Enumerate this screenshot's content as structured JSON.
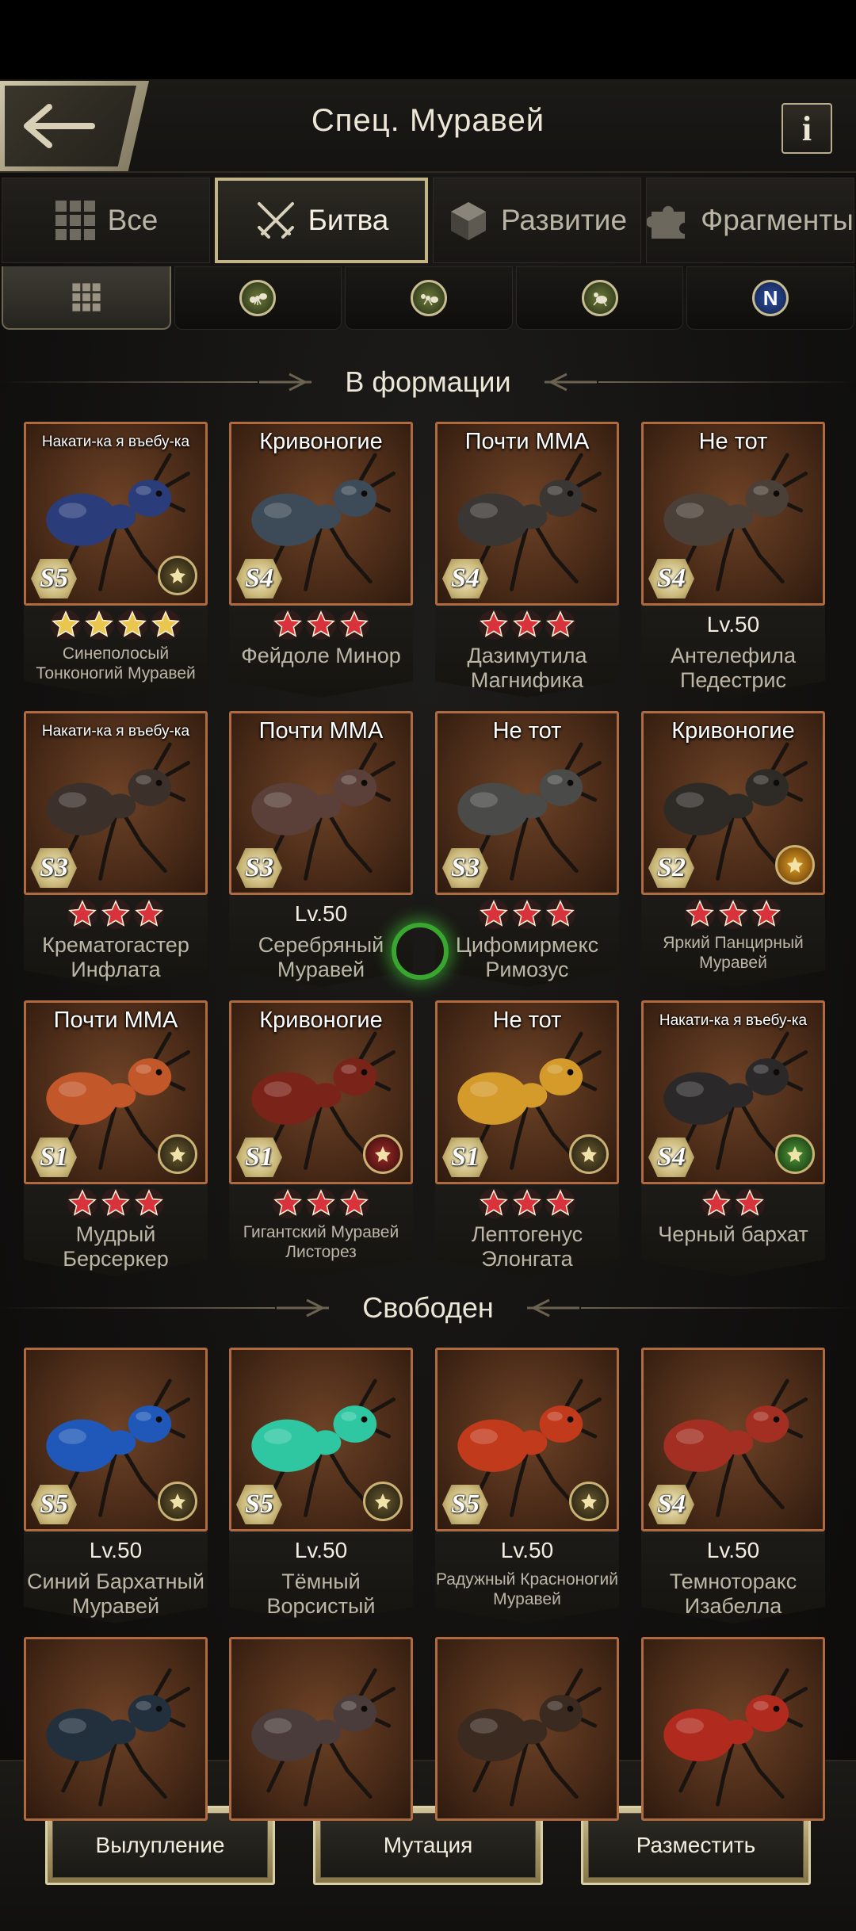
{
  "header": {
    "title": "Спец. Муравей",
    "info_label": "i"
  },
  "tabs": [
    {
      "label": "Все",
      "icon": "grid-icon",
      "active": false
    },
    {
      "label": "Битва",
      "icon": "crossed-swords-icon",
      "active": true
    },
    {
      "label": "Развитие",
      "icon": "cube-icon",
      "active": false
    },
    {
      "label": "Фрагменты",
      "icon": "puzzle-icon",
      "active": false
    }
  ],
  "subtabs": [
    {
      "icon": "grid-icon",
      "active": true
    },
    {
      "icon": "ant-type-icon",
      "active": false
    },
    {
      "icon": "ant-type-icon",
      "active": false
    },
    {
      "icon": "ant-type-icon",
      "active": false
    },
    {
      "icon": "n-rarity-icon",
      "label": "N",
      "active": false
    }
  ],
  "sections": {
    "in_formation": "В формации",
    "free": "Свободен"
  },
  "formation_cards": [
    {
      "tag": "Накати-ка я въебу-ка",
      "grade": "S5",
      "stars": 4,
      "star_color": "gold",
      "level": "",
      "name": "Синеполосый Тонконогий Муравей",
      "name_small": true,
      "body": "#2a3d7a",
      "badge": "gold"
    },
    {
      "tag": "Кривоногие",
      "grade": "S4",
      "stars": 3,
      "star_color": "red",
      "level": "",
      "name": "Фейдоле Минор",
      "name_small": false,
      "body": "#3d4a57",
      "badge": ""
    },
    {
      "tag": "Почти ММА",
      "grade": "S4",
      "stars": 3,
      "star_color": "red",
      "level": "",
      "name": "Дазимутила Магнифика",
      "name_small": false,
      "body": "#3a3634",
      "badge": ""
    },
    {
      "tag": "Не тот",
      "grade": "S4",
      "stars": 0,
      "star_color": "",
      "level": "Lv.50",
      "name": "Антелефила Педестрис",
      "name_small": false,
      "body": "#4a4038",
      "badge": ""
    },
    {
      "tag": "Накати-ка я въебу-ка",
      "grade": "S3",
      "stars": 3,
      "star_color": "red",
      "level": "",
      "name": "Крематогастер Инфлата",
      "name_small": false,
      "body": "#3b302a",
      "badge": ""
    },
    {
      "tag": "Почти ММА",
      "grade": "S3",
      "stars": 0,
      "star_color": "",
      "level": "Lv.50",
      "name": "Серебряный Муравей",
      "name_small": false,
      "body": "#5a4038",
      "badge": ""
    },
    {
      "tag": "Не тот",
      "grade": "S3",
      "stars": 3,
      "star_color": "red",
      "level": "",
      "name": "Цифомирмекс Римозус",
      "name_small": false,
      "body": "#4a4a48",
      "badge": ""
    },
    {
      "tag": "Кривоногие",
      "grade": "S2",
      "stars": 3,
      "star_color": "red",
      "level": "",
      "name": "Яркий Панцирный Муравей",
      "name_small": true,
      "body": "#2e2a26",
      "badge": "orange"
    },
    {
      "tag": "Почти ММА",
      "grade": "S1",
      "stars": 3,
      "star_color": "red",
      "level": "",
      "name": "Мудрый Берсеркер",
      "name_small": false,
      "body": "#c2572a",
      "badge": "gold"
    },
    {
      "tag": "Кривоногие",
      "grade": "S1",
      "stars": 3,
      "star_color": "red",
      "level": "",
      "name": "Гигантский Муравей Листорез",
      "name_small": true,
      "body": "#7a2318",
      "badge": "red"
    },
    {
      "tag": "Не тот",
      "grade": "S1",
      "stars": 3,
      "star_color": "red",
      "level": "",
      "name": "Лептогенус Элонгата",
      "name_small": false,
      "body": "#d49a2a",
      "badge": "gold"
    },
    {
      "tag": "Накати-ка я въебу-ка",
      "grade": "S4",
      "stars": 2,
      "star_color": "red",
      "level": "",
      "name": "Черный бархат",
      "name_small": false,
      "body": "#2a2828",
      "badge": "green"
    }
  ],
  "free_cards": [
    {
      "tag": "",
      "grade": "S5",
      "stars": 0,
      "star_color": "",
      "level": "Lv.50",
      "name": "Синий Бархатный Муравей",
      "name_small": false,
      "body": "#1f58b8",
      "badge": "gold"
    },
    {
      "tag": "",
      "grade": "S5",
      "stars": 0,
      "star_color": "",
      "level": "Lv.50",
      "name": "Тёмный Ворсистый Муравей",
      "name_small": false,
      "body": "#2fc7a2",
      "badge": "gold"
    },
    {
      "tag": "",
      "grade": "S5",
      "stars": 0,
      "star_color": "",
      "level": "Lv.50",
      "name": "Радужный Красноногий Муравей",
      "name_small": true,
      "body": "#c23a1c",
      "badge": "gold"
    },
    {
      "tag": "",
      "grade": "S4",
      "stars": 0,
      "star_color": "",
      "level": "Lv.50",
      "name": "Темноторакс Изабелла",
      "name_small": false,
      "body": "#a32f22",
      "badge": ""
    }
  ],
  "partial_cards": [
    {
      "body": "#22303d"
    },
    {
      "body": "#4a3c3a"
    },
    {
      "body": "#3a2a20"
    },
    {
      "body": "#b02a1e"
    }
  ],
  "actions": {
    "hatch": "Вылупление",
    "mutate": "Мутация",
    "place": "Разместить"
  },
  "colors": {
    "accent_gold": "#c4b587",
    "card_border": "#b06a3f",
    "star_red": "#d8333d",
    "star_gold": "#e8c650"
  }
}
